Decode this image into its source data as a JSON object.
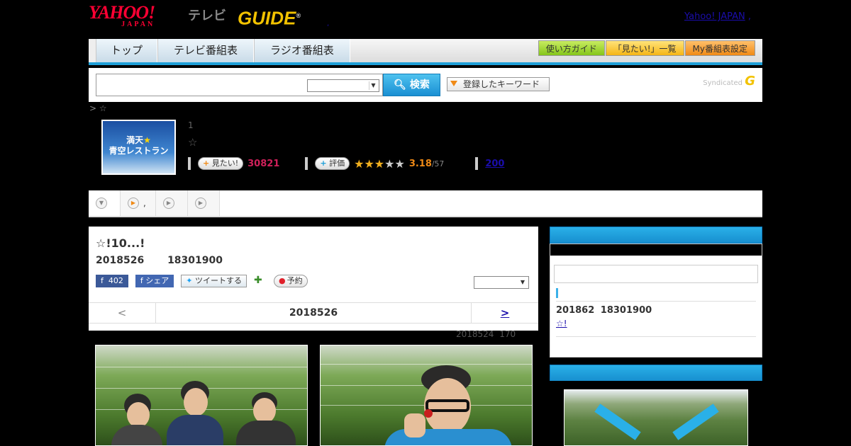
{
  "header": {
    "yahoo_logo": "YAHOO!",
    "yahoo_logo_sub": "JAPAN",
    "tv_label": "テレビ",
    "gguide_logo": "GUIDE",
    "gguide_mark": "®",
    "dot": ",",
    "yahoo_japan_link": "Yahoo! JAPAN",
    "link_trailing": ","
  },
  "nav": {
    "tabs": [
      "トップ",
      "テレビ番組表",
      "ラジオ番組表"
    ],
    "buttons": [
      "使い方ガイド",
      "「見たい!」一覧",
      "My番組表設定"
    ]
  },
  "search": {
    "input_value": "",
    "select_value": "",
    "search_button": "検索",
    "keyword_button": "登録したキーワード",
    "syndicated": "Syndicated",
    "syndicated_logo": "G"
  },
  "program": {
    "breadcrumb": "> ☆",
    "thumb_line1": "満天",
    "thumb_star": "★",
    "thumb_line2": "青空レストラン",
    "info_line1": "1",
    "info_line2": "☆",
    "want_button": "見たい!",
    "want_count": "30821",
    "rate_button": "評価",
    "stars_filled": "★★★",
    "stars_empty": "★★",
    "rating": "3.18",
    "rating_total": "/57",
    "reviews": "200"
  },
  "subtabs": {
    "tab2_label": ","
  },
  "episode": {
    "title": "☆!10...!",
    "date": "2018526 18301900",
    "fb_like_count": "402",
    "fb_share": "シェア",
    "tweet": "ツイートする",
    "reserve": "予約",
    "select_value": "",
    "pager_prev": "<",
    "pager_date": "2018526",
    "pager_next": ">",
    "updated": "2018524 170"
  },
  "sidebar": {
    "next_date": "201862 18301900",
    "next_link": "☆!"
  },
  "colors": {
    "accent_blue": "#1e9fd8",
    "want_red": "#d0205a",
    "rating_orange": "#f08a16"
  }
}
